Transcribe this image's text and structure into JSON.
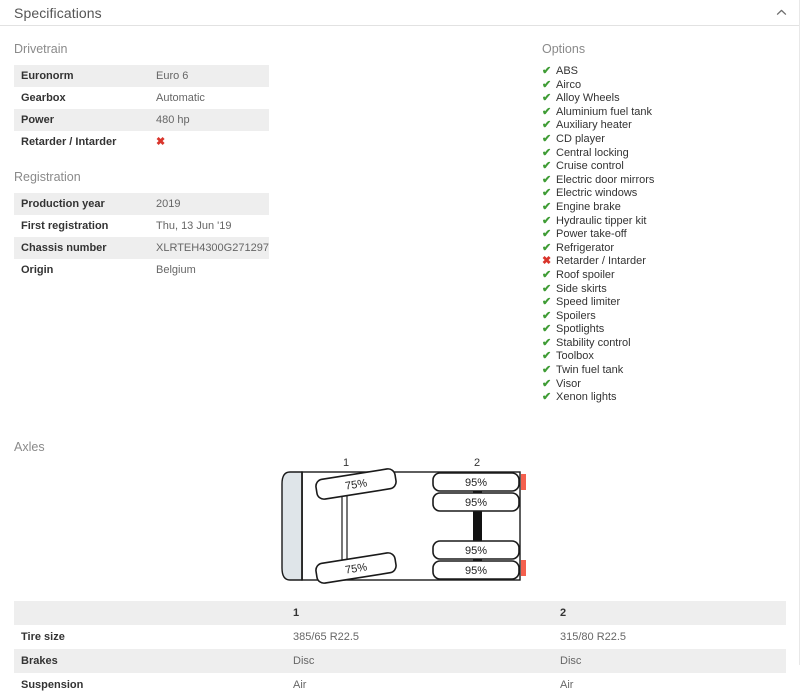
{
  "panel": {
    "title": "Specifications",
    "collapse_icon": "chevron-up-icon"
  },
  "drivetrain": {
    "heading": "Drivetrain",
    "rows": [
      {
        "label": "Euronorm",
        "value": "Euro 6",
        "type": "text"
      },
      {
        "label": "Gearbox",
        "value": "Automatic",
        "type": "text"
      },
      {
        "label": "Power",
        "value": "480 hp",
        "type": "text"
      },
      {
        "label": "Retarder / Intarder",
        "value": "✖",
        "type": "mark-no"
      }
    ]
  },
  "registration": {
    "heading": "Registration",
    "rows": [
      {
        "label": "Production year",
        "value": "2019",
        "type": "text"
      },
      {
        "label": "First registration",
        "value": "Thu, 13 Jun '19",
        "type": "text"
      },
      {
        "label": "Chassis number",
        "value": "XLRTEH4300G271297",
        "type": "text"
      },
      {
        "label": "Origin",
        "value": "Belgium",
        "type": "text"
      }
    ]
  },
  "options": {
    "heading": "Options",
    "check_icon": "check-icon",
    "cross_icon": "cross-icon",
    "items": [
      {
        "label": "ABS",
        "present": true,
        "mark": "✔"
      },
      {
        "label": "Airco",
        "present": true,
        "mark": "✔"
      },
      {
        "label": "Alloy Wheels",
        "present": true,
        "mark": "✔"
      },
      {
        "label": "Aluminium fuel tank",
        "present": true,
        "mark": "✔"
      },
      {
        "label": "Auxiliary heater",
        "present": true,
        "mark": "✔"
      },
      {
        "label": "CD player",
        "present": true,
        "mark": "✔"
      },
      {
        "label": "Central locking",
        "present": true,
        "mark": "✔"
      },
      {
        "label": "Cruise control",
        "present": true,
        "mark": "✔"
      },
      {
        "label": "Electric door mirrors",
        "present": true,
        "mark": "✔"
      },
      {
        "label": "Electric windows",
        "present": true,
        "mark": "✔"
      },
      {
        "label": "Engine brake",
        "present": true,
        "mark": "✔"
      },
      {
        "label": "Hydraulic tipper kit",
        "present": true,
        "mark": "✔"
      },
      {
        "label": "Power take-off",
        "present": true,
        "mark": "✔"
      },
      {
        "label": "Refrigerator",
        "present": true,
        "mark": "✔"
      },
      {
        "label": "Retarder / Intarder",
        "present": false,
        "mark": "✖"
      },
      {
        "label": "Roof spoiler",
        "present": true,
        "mark": "✔"
      },
      {
        "label": "Side skirts",
        "present": true,
        "mark": "✔"
      },
      {
        "label": "Speed limiter",
        "present": true,
        "mark": "✔"
      },
      {
        "label": "Spoilers",
        "present": true,
        "mark": "✔"
      },
      {
        "label": "Spotlights",
        "present": true,
        "mark": "✔"
      },
      {
        "label": "Stability control",
        "present": true,
        "mark": "✔"
      },
      {
        "label": "Toolbox",
        "present": true,
        "mark": "✔"
      },
      {
        "label": "Twin fuel tank",
        "present": true,
        "mark": "✔"
      },
      {
        "label": "Visor",
        "present": true,
        "mark": "✔"
      },
      {
        "label": "Xenon lights",
        "present": true,
        "mark": "✔"
      }
    ]
  },
  "axles": {
    "heading": "Axles",
    "diagram": {
      "axle_numbers": [
        "1",
        "2"
      ],
      "tread_labels": {
        "axle1_top": "75%",
        "axle1_bottom": "75%",
        "axle2_top_outer": "95%",
        "axle2_top_inner": "95%",
        "axle2_bottom_inner": "95%",
        "axle2_bottom_outer": "95%"
      },
      "colors": {
        "cab_fill": "#dfe5e9",
        "outline": "#1a1a1a",
        "marker_red": "#f4604e"
      }
    },
    "table": {
      "columns": [
        "",
        "1",
        "2"
      ],
      "rows": [
        {
          "label": "Tire size",
          "values": [
            "385/65 R22.5",
            "315/80 R22.5"
          ]
        },
        {
          "label": "Brakes",
          "values": [
            "Disc",
            "Disc"
          ]
        },
        {
          "label": "Suspension",
          "values": [
            "Air",
            "Air"
          ]
        }
      ]
    }
  },
  "colors": {
    "row_stripe": "#eeeeee",
    "heading_gray": "#8a8a8a",
    "check_green": "#3f9c35",
    "cross_red": "#d9342b",
    "border": "#e2e2e2"
  }
}
